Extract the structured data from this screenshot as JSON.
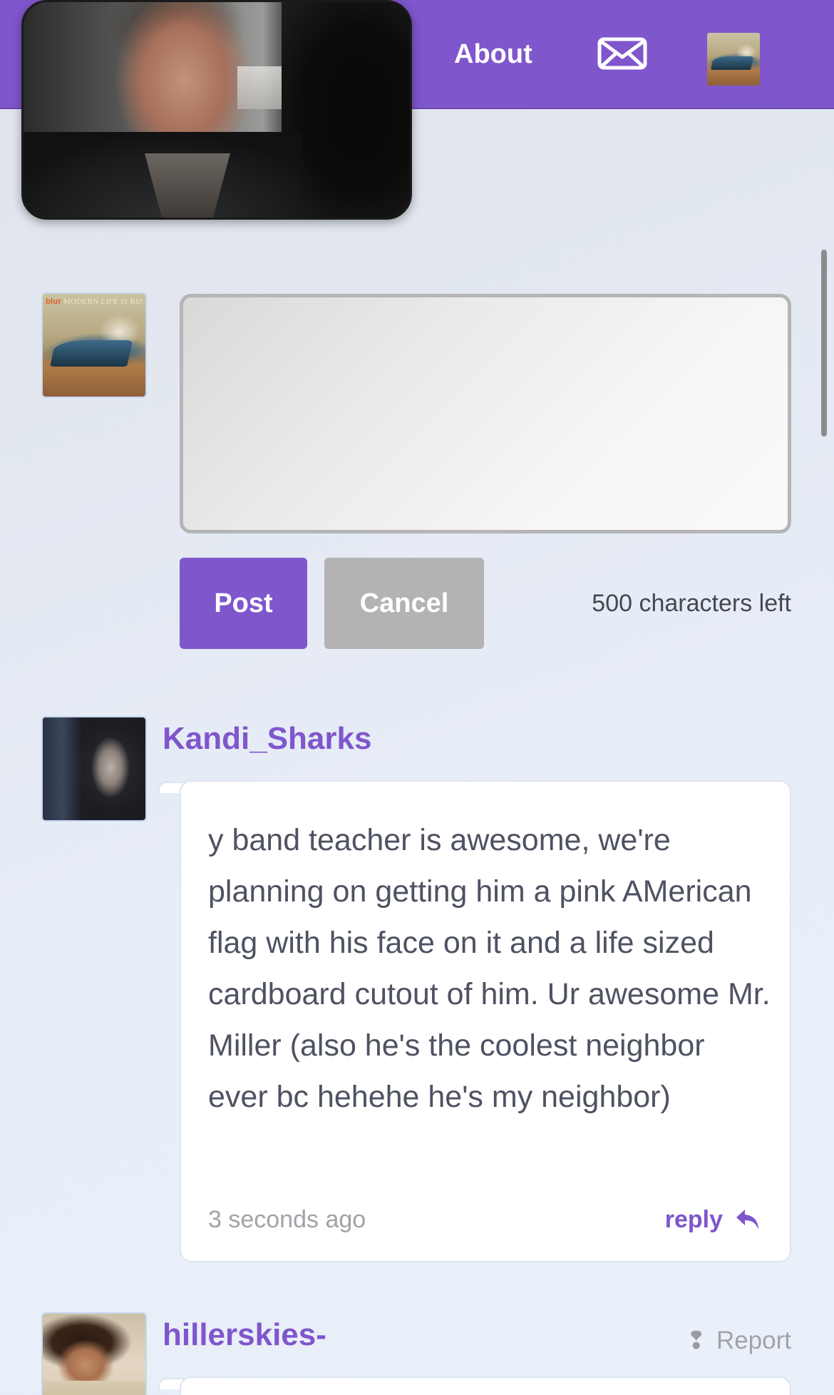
{
  "header": {
    "nav_about": "About",
    "mail_icon": "mail-icon",
    "accent_color": "#7f56cc"
  },
  "composer": {
    "textarea_value": "",
    "post_label": "Post",
    "cancel_label": "Cancel",
    "chars_left": "500 characters left"
  },
  "avatar_album": {
    "band": "blur",
    "title": "MODERN LIFE IS RUBBISH"
  },
  "comments": [
    {
      "username": "Kandi_Sharks",
      "text": "y band teacher is awesome, we're planning on getting him a pink AMerican flag with his face on it and a life sized cardboard cutout of him. Ur awesome Mr. Miller (also he's the coolest neighbor ever bc hehehe he's my neighbor)",
      "timestamp": "3 seconds ago",
      "reply_label": "reply"
    },
    {
      "username": "hillerskies-",
      "report_label": "Report"
    }
  ]
}
